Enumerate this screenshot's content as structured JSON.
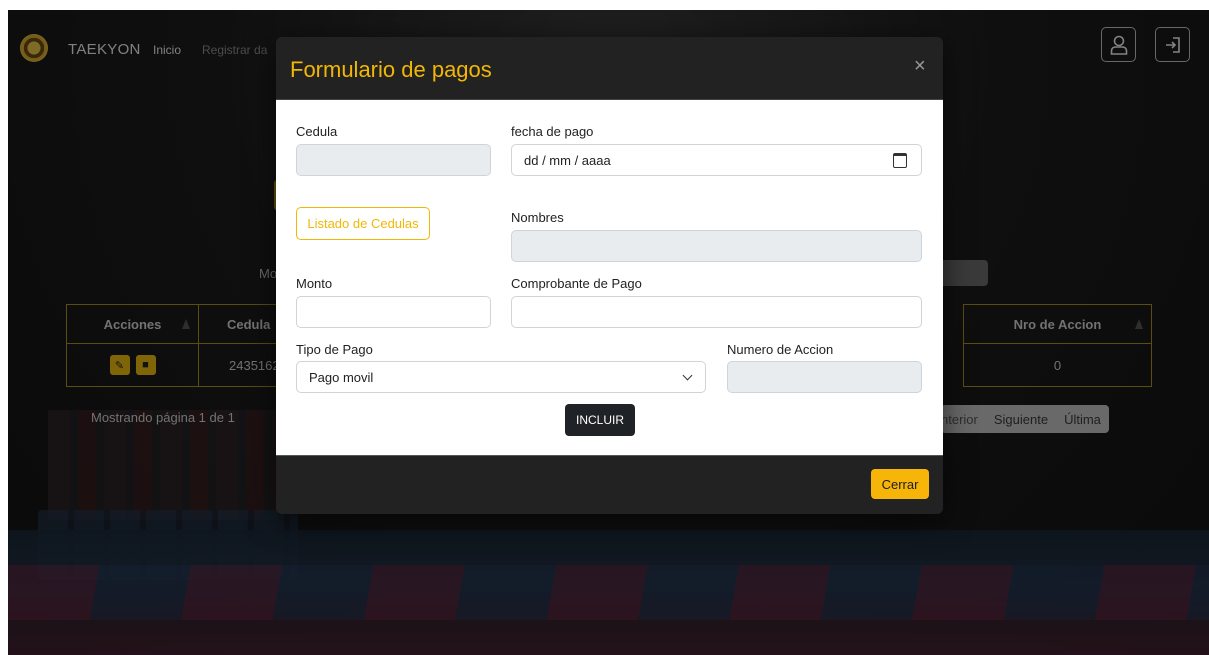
{
  "nav": {
    "brand": "TAEKYON",
    "links": [
      "Inicio",
      "Registrar da"
    ]
  },
  "background": {
    "mo_text": "Mo",
    "table_headers": [
      "Acciones",
      "Cedula",
      "Nro de Accion"
    ],
    "row": {
      "cedula": "2435162",
      "nro_accion": "0"
    },
    "mostrando": "Mostrando página 1 de 1",
    "pagination": [
      "nterior",
      "Siguiente",
      "Última"
    ]
  },
  "modal": {
    "title": "Formulario de pagos",
    "close": "×",
    "fields": {
      "cedula_label": "Cedula",
      "fecha_label": "fecha de pago",
      "fecha_value": "dd / mm / aaaa",
      "listado_button": "Listado de Cedulas",
      "nombres_label": "Nombres",
      "monto_label": "Monto",
      "comprobante_label": "Comprobante de Pago",
      "tipo_pago_label": "Tipo de Pago",
      "tipo_pago_value": "Pago movil",
      "numero_accion_label": "Numero de Accion"
    },
    "incluir_button": "INCLUIR",
    "cerrar_button": "Cerrar"
  },
  "colors": {
    "accent": "#f2b705",
    "dark": "#222222"
  }
}
